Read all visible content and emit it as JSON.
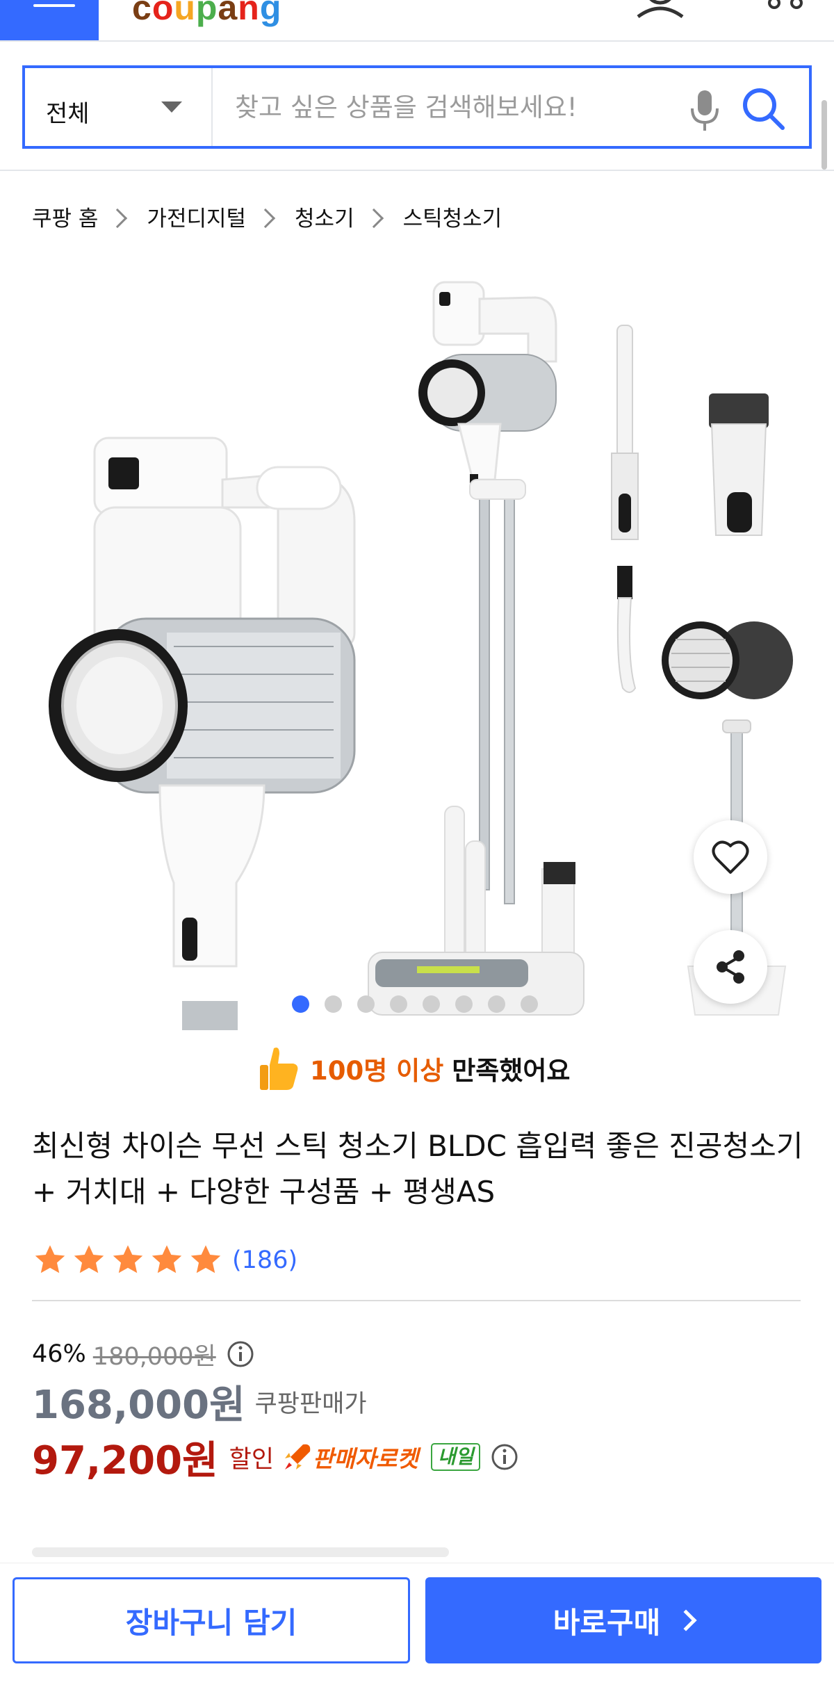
{
  "header": {
    "logo_text": "coupang",
    "menu_icon": "hamburger-menu-icon",
    "user_icon": "user-icon",
    "more_icon": "more-icon"
  },
  "search": {
    "category": "전체",
    "placeholder": "찾고 싶은 상품을 검색해보세요!",
    "value": ""
  },
  "breadcrumb": [
    "쿠팡 홈",
    "가전디지털",
    "청소기",
    "스틱청소기"
  ],
  "gallery": {
    "total_images": 8,
    "current_index": 1
  },
  "satisfaction": {
    "highlight": "100명 이상",
    "rest": "만족했어요"
  },
  "product": {
    "title": "최신형 차이슨 무선 스틱 청소기 BLDC 흡입력 좋은 진공청소기 + 거치대 + 다양한 구성품 + 평생AS",
    "rating": 5,
    "rating_max": 5,
    "review_count": "(186)"
  },
  "price": {
    "discount_rate": "46%",
    "original_price": "180,000원",
    "sale_price": "168,000원",
    "sale_label": "쿠팡판매가",
    "final_price": "97,200원",
    "discount_label": "할인",
    "rocket_label": "판매자로켓",
    "delivery_badge": "내일"
  },
  "colors": {
    "accent": "#346aff",
    "price_red": "#b3190e",
    "star": "#ff8a3d",
    "rocket_orange": "#f05a00",
    "badge_green": "#2b9a30"
  },
  "actions": {
    "cart_label": "장바구니 담기",
    "buy_label": "바로구매"
  }
}
